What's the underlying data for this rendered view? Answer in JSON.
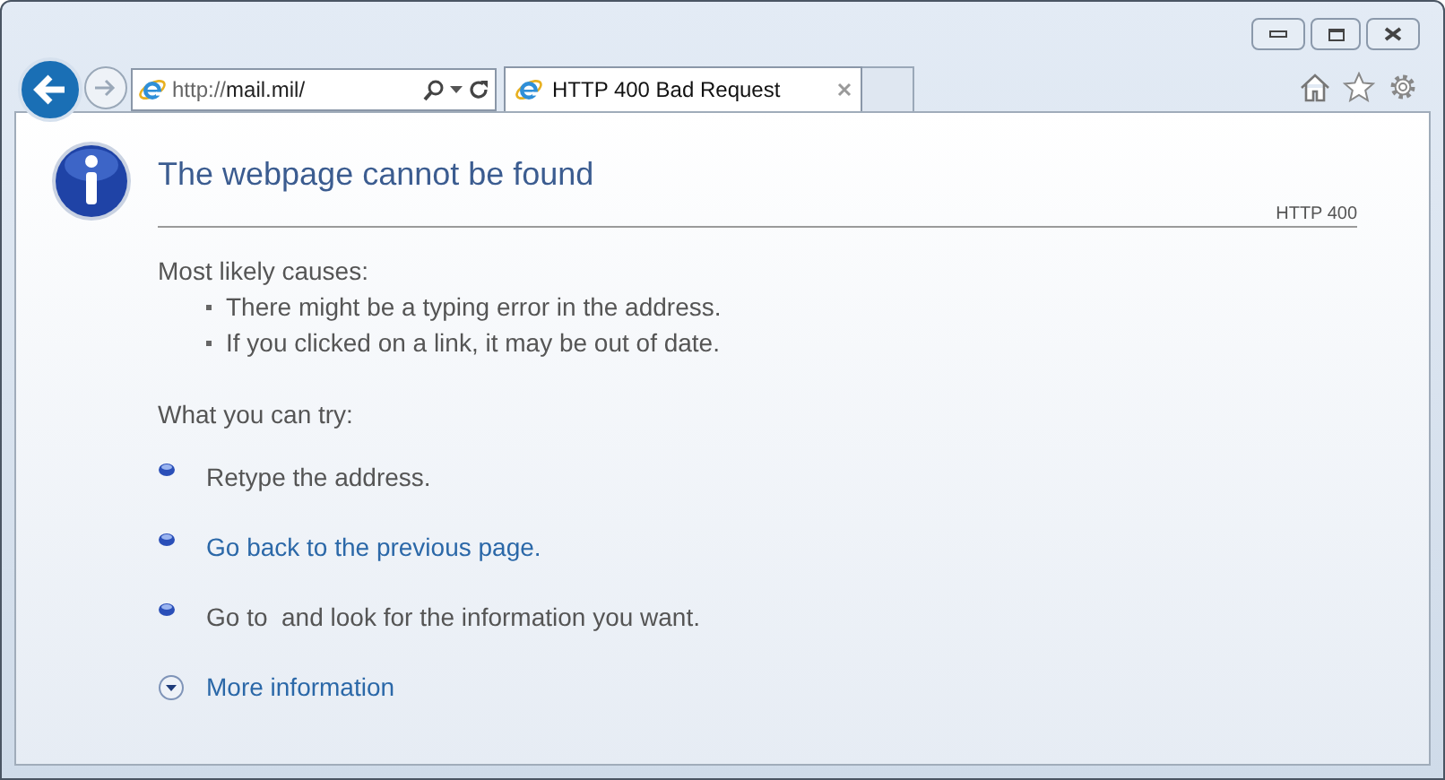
{
  "address_bar": {
    "url_prefix": "http://",
    "url_host": "mail.mil/"
  },
  "tabs": [
    {
      "title": "HTTP 400 Bad Request",
      "selected": true
    }
  ],
  "page": {
    "title": "The webpage cannot be found",
    "error_code": "HTTP 400",
    "causes_heading": "Most likely causes:",
    "causes": [
      "There might be a typing error in the address.",
      "If you clicked on a link, it may be out of date."
    ],
    "try_heading": "What you can try:",
    "suggestions": [
      {
        "kind": "text",
        "text": "Retype the address."
      },
      {
        "kind": "link",
        "text": "Go back to the previous page."
      },
      {
        "kind": "text",
        "text": "Go to  and look for the information you want."
      }
    ],
    "more_info": {
      "text": "More information",
      "expanded": false
    }
  }
}
